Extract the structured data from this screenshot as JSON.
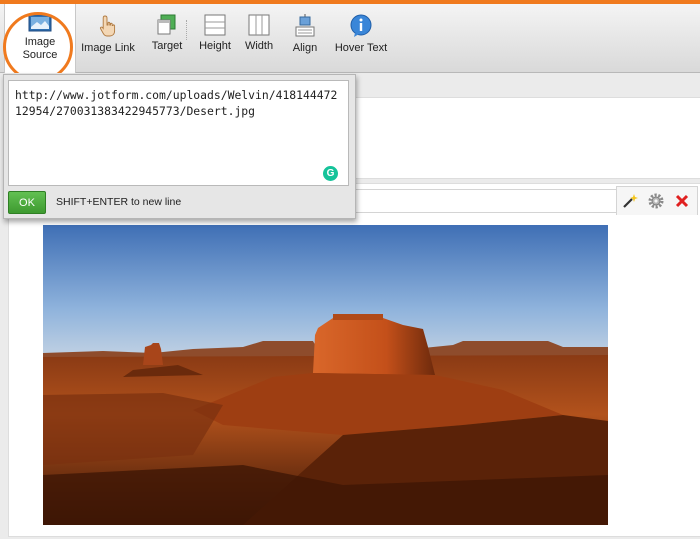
{
  "toolbar": {
    "buttons": [
      {
        "label_line1": "Image",
        "label_line2": "Source"
      },
      {
        "label": "Image Link"
      },
      {
        "label": "Target"
      },
      {
        "label": "Height"
      },
      {
        "label": "Width"
      },
      {
        "label": "Align"
      },
      {
        "label": "Hover Text"
      }
    ]
  },
  "popup": {
    "url_value": "http://www.jotform.com/uploads/Welvin/41814447212954/270031383422945773/Desert.jpg",
    "ok_label": "OK",
    "hint": "SHIFT+ENTER to new line",
    "grammarly_badge": "G"
  },
  "colors": {
    "accent": "#f07a1e",
    "ok_green": "#4aa83a"
  }
}
